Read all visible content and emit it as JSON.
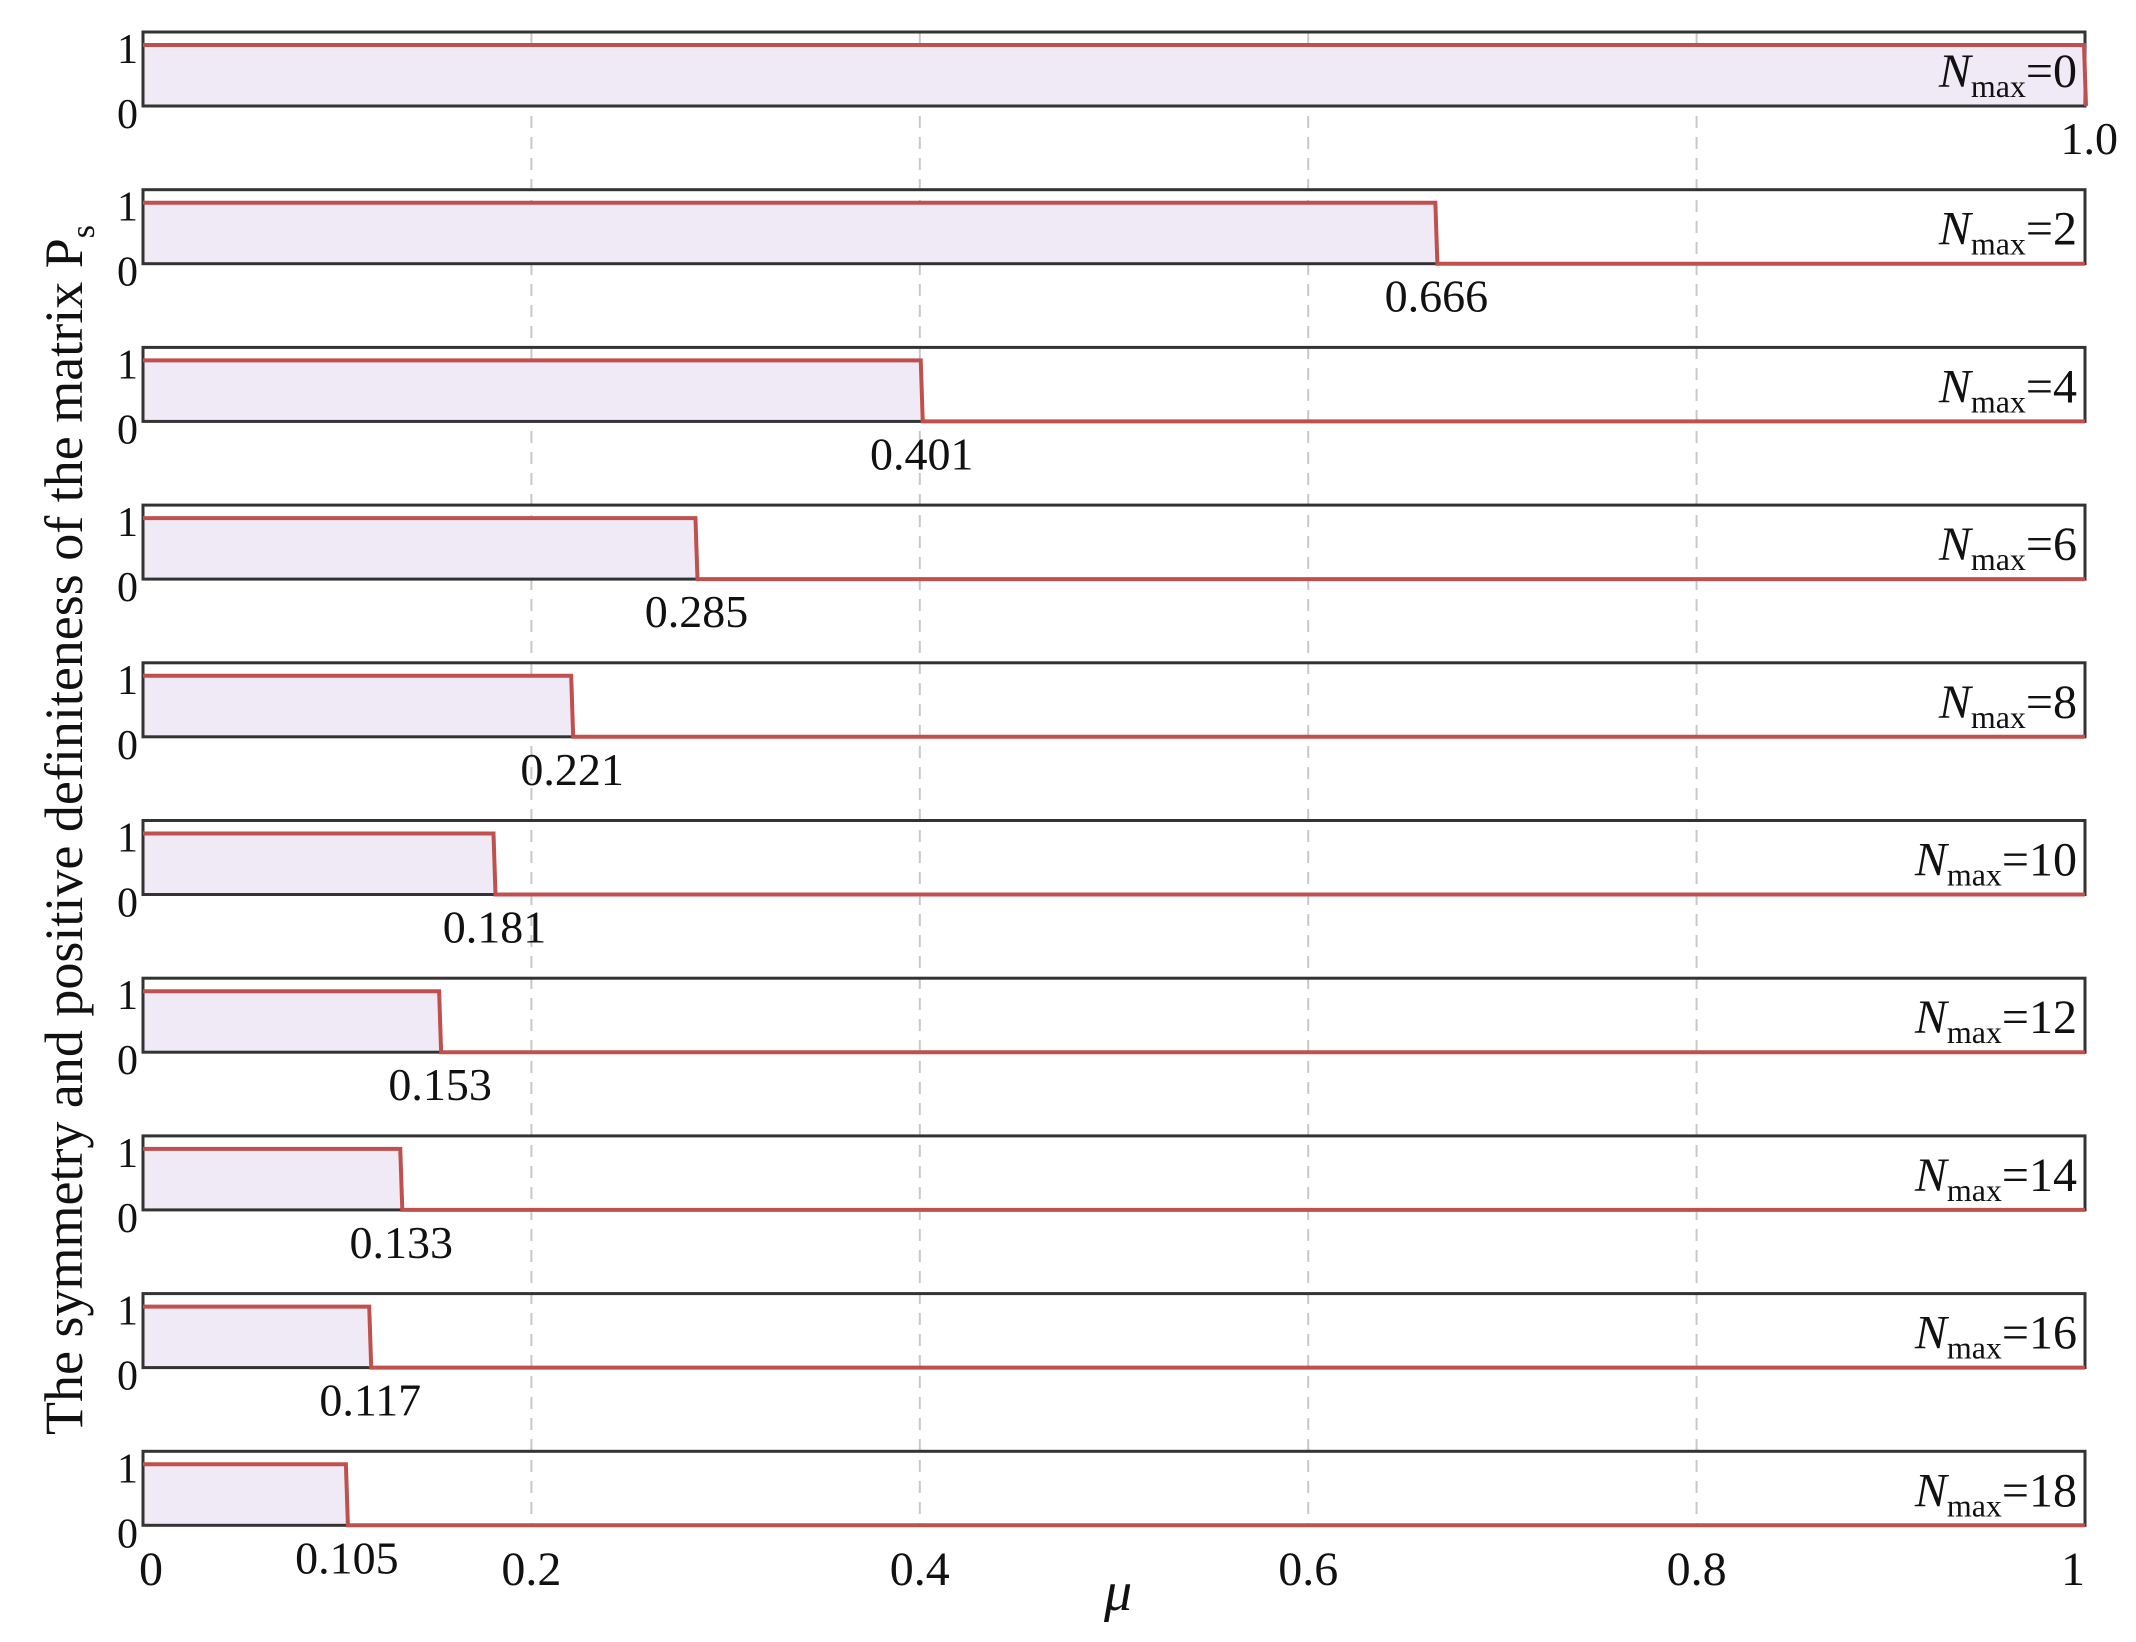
{
  "chart_data": {
    "type": "line",
    "subtype": "step-panels",
    "xlabel": "μ",
    "ylabel": "The symmetry and positive definiteness of the matrix P",
    "ylabel_subscript": "s",
    "xlim": [
      0,
      1
    ],
    "ylim": [
      0,
      1
    ],
    "x_ticks": [
      "0",
      "0.2",
      "0.4",
      "0.6",
      "0.8",
      "1"
    ],
    "x_tick_values": [
      0,
      0.2,
      0.4,
      0.6,
      0.8,
      1
    ],
    "y_ticks": [
      "0",
      "1"
    ],
    "grid": "vertical dashed at x ticks",
    "panel_label_prefix": "N",
    "panel_label_subscript": "max",
    "series": [
      {
        "name": "Nmax=0",
        "n": "0",
        "threshold": 1.0,
        "threshold_label": "1.0"
      },
      {
        "name": "Nmax=2",
        "n": "2",
        "threshold": 0.666,
        "threshold_label": "0.666"
      },
      {
        "name": "Nmax=4",
        "n": "4",
        "threshold": 0.401,
        "threshold_label": "0.401"
      },
      {
        "name": "Nmax=6",
        "n": "6",
        "threshold": 0.285,
        "threshold_label": "0.285"
      },
      {
        "name": "Nmax=8",
        "n": "8",
        "threshold": 0.221,
        "threshold_label": "0.221"
      },
      {
        "name": "Nmax=10",
        "n": "10",
        "threshold": 0.181,
        "threshold_label": "0.181"
      },
      {
        "name": "Nmax=12",
        "n": "12",
        "threshold": 0.153,
        "threshold_label": "0.153"
      },
      {
        "name": "Nmax=14",
        "n": "14",
        "threshold": 0.133,
        "threshold_label": "0.133"
      },
      {
        "name": "Nmax=16",
        "n": "16",
        "threshold": 0.117,
        "threshold_label": "0.117"
      },
      {
        "name": "Nmax=18",
        "n": "18",
        "threshold": 0.105,
        "threshold_label": "0.105"
      }
    ],
    "colors": {
      "line": "#c0504d",
      "fill": "#efeaf6",
      "frame": "#333333",
      "grid": "#c8c8cc"
    }
  }
}
